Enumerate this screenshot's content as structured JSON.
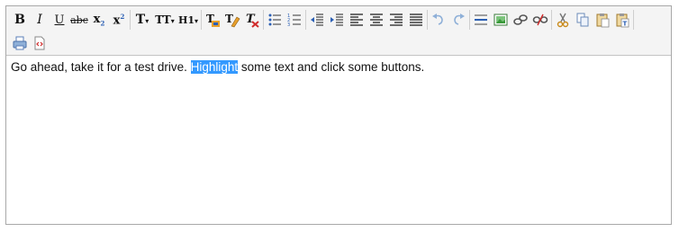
{
  "toolbar": {
    "bold_label": "B",
    "italic_label": "I",
    "underline_label": "U",
    "strike_label": "abc",
    "subscript_label": "x",
    "superscript_label": "x",
    "font_label": "T",
    "fontsize_label": "TT",
    "heading_label": "H1"
  },
  "editor": {
    "text_before": "Go ahead, take it for a test drive. ",
    "text_highlighted": "Highlight",
    "text_after": " some text and click some buttons."
  },
  "colors": {
    "toolbar_bg": "#f4f4f4",
    "border": "#a9a9a9",
    "selection": "#3399ff",
    "icon_blue": "#2b5fb4",
    "icon_orange": "#e8a02c",
    "icon_red": "#d02a2a",
    "icon_green": "#3a9a3a"
  }
}
